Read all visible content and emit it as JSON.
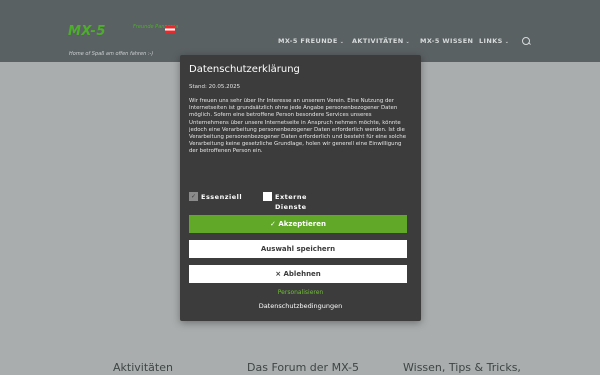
{
  "header": {
    "logo_text": "MX-5",
    "logo_small": "Freunde Pannonia",
    "tagline": "Home of Spaß am offen fahren :-)",
    "nav": [
      {
        "label": "MX-5 FREUNDE",
        "dropdown": true
      },
      {
        "label": "AKTIVITÄTEN",
        "dropdown": true
      },
      {
        "label": "MX-5 WISSEN",
        "dropdown": false
      },
      {
        "label": "LINKS",
        "dropdown": true
      }
    ],
    "chevron": "⌄"
  },
  "bottom": {
    "col1": "Aktivitäten",
    "col2": "Das Forum der MX-5",
    "col3": "Wissen, Tips & Tricks,"
  },
  "modal": {
    "title": "Datenschutzerklärung",
    "stand": "Stand: 20.05.2025",
    "policy": "Wir freuen uns sehr über Ihr Interesse an unserem Verein. Eine Nutzung der Internetseiten ist grundsätzlich ohne jede Angabe personenbezogener Daten möglich. Sofern eine betroffene Person besondere Services unseres Unternehmens über unsere Internetseite in Anspruch nehmen möchte, könnte jedoch eine Verarbeitung personenbezogener Daten erforderlich werden. Ist die Verarbeitung personenbezogener Daten erforderlich und besteht für eine solche Verarbeitung keine gesetzliche Grundlage, holen wir generell eine Einwilligung der betroffenen Person ein.",
    "checkbox_essential": {
      "label": "Essenziell",
      "checked": true
    },
    "checkbox_external": {
      "label_line1": "Externe",
      "label_line2": "Dienste",
      "checked": false
    },
    "accept_label": "✓ Akzeptieren",
    "save_label": "Auswahl speichern",
    "reject_label": "× Ablehnen",
    "personalize_label": "Personalisieren",
    "privacy_terms_label": "Datenschutzbedingungen"
  },
  "colors": {
    "accent": "#61a829",
    "header_bg": "#5a6163",
    "modal_bg": "#3c3c3c",
    "page_bg": "#a9adad"
  }
}
